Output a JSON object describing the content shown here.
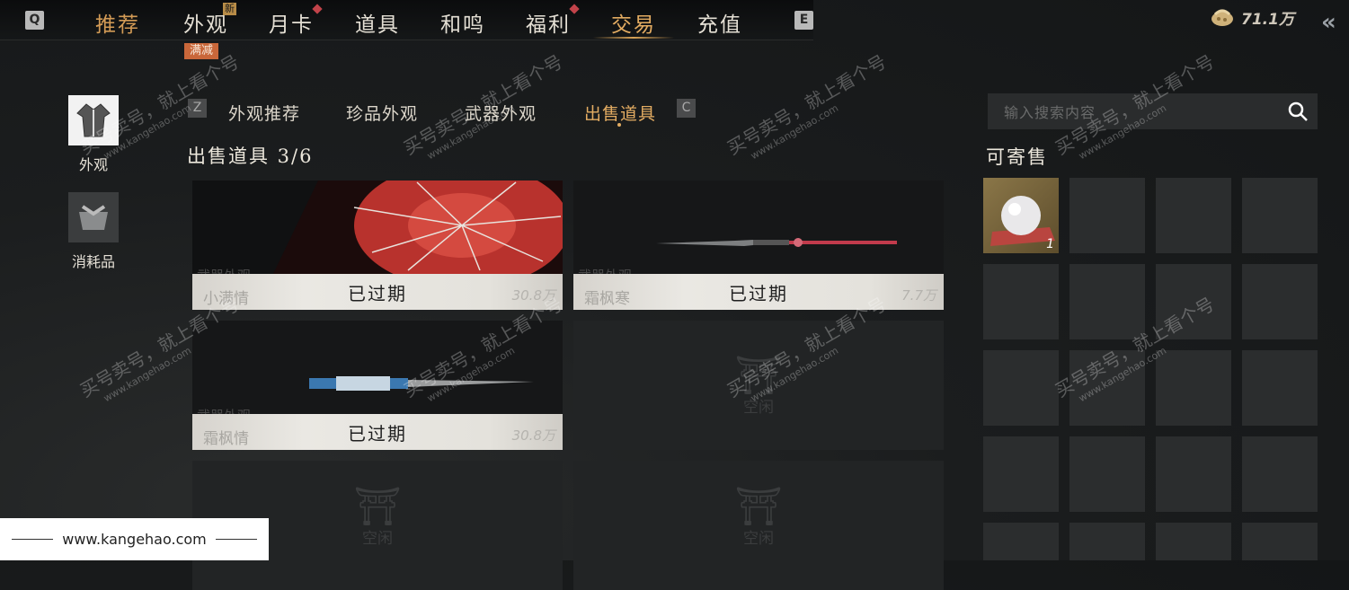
{
  "topnav": {
    "key_left": "Q",
    "key_right": "E",
    "tabs": [
      {
        "label": "推荐"
      },
      {
        "label": "外观"
      },
      {
        "label": "月卡"
      },
      {
        "label": "道具"
      },
      {
        "label": "和鸣"
      },
      {
        "label": "福利"
      },
      {
        "label": "交易"
      },
      {
        "label": "充值"
      }
    ],
    "badge_new": "新",
    "badge_sale": "满减",
    "active_tab": "交易"
  },
  "currency": {
    "icon": "coin-pouch-icon",
    "value": "71.1万"
  },
  "leftnav": [
    {
      "label": "外观",
      "icon": "robe-icon",
      "selected": true
    },
    {
      "label": "消耗品",
      "icon": "bundle-icon",
      "selected": false
    }
  ],
  "subnav": {
    "key_left": "Z",
    "key_right": "C",
    "tabs": [
      "外观推荐",
      "珍品外观",
      "武器外观",
      "出售道具"
    ],
    "active": "出售道具"
  },
  "listings": {
    "title": "出售道具 3/6",
    "items": [
      {
        "tag": "武器外观",
        "name": "小满情",
        "status": "已过期",
        "price": "30.8万"
      },
      {
        "tag": "武器外观",
        "name": "霜枫寒",
        "status": "已过期",
        "price": "7.7万"
      },
      {
        "tag": "武器外观",
        "name": "霜枫情",
        "status": "已过期",
        "price": "30.8万"
      },
      {
        "status": "空闲"
      },
      {
        "status": "空闲"
      },
      {
        "status": "空闲"
      }
    ]
  },
  "search": {
    "placeholder": "输入搜索内容",
    "icon": "search-icon"
  },
  "consign": {
    "title": "可寄售",
    "first_item_qty": "1"
  },
  "watermark": {
    "text": "买号卖号，就上看个号",
    "url": "www.kangehao.com",
    "brand": "看个号"
  },
  "footer": {
    "url": "www.kangehao.com"
  }
}
